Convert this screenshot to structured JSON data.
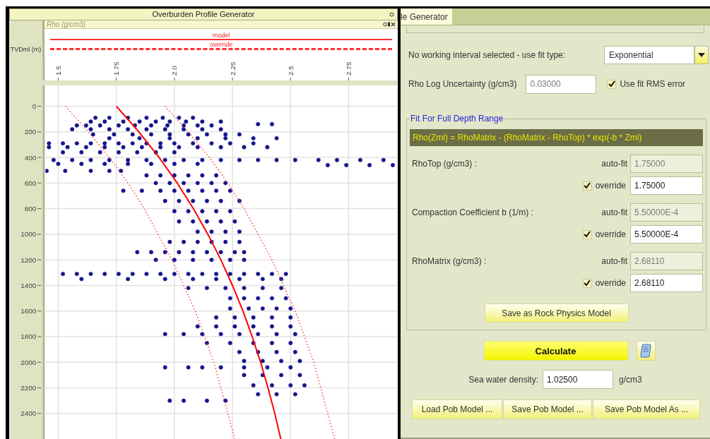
{
  "left_panel": {
    "title": "Overburden Profile Generator",
    "depth_label": "TVDml (m)",
    "track": {
      "title": "Rho (g/cm3)",
      "legend": [
        {
          "label": "model",
          "kind": "solid"
        },
        {
          "label": "override",
          "kind": "dashed"
        }
      ],
      "chart_data": {
        "type": "scatter",
        "grid": true,
        "xlim": [
          1.445,
          2.96
        ],
        "ylim": [
          2600,
          -163
        ],
        "xticks": [
          {
            "value": 1.5,
            "label": "1.5"
          },
          {
            "value": 1.75,
            "label": "1.75"
          },
          {
            "value": 2,
            "label": "2.0"
          },
          {
            "value": 2.25,
            "label": "2.25"
          },
          {
            "value": 2.5,
            "label": "2.5"
          },
          {
            "value": 2.75,
            "label": "2.75"
          }
        ],
        "yticks": [
          {
            "value": 0,
            "label": "0"
          },
          {
            "value": 200,
            "label": "200"
          },
          {
            "value": 400,
            "label": "400"
          },
          {
            "value": 600,
            "label": "600"
          },
          {
            "value": 800,
            "label": "800"
          },
          {
            "value": 1000,
            "label": "1000"
          },
          {
            "value": 1200,
            "label": "1200"
          },
          {
            "value": 1400,
            "label": "1400"
          },
          {
            "value": 1600,
            "label": "1600"
          },
          {
            "value": 1800,
            "label": "1800"
          },
          {
            "value": 2000,
            "label": "2000"
          },
          {
            "value": 2200,
            "label": "2200"
          },
          {
            "value": 2400,
            "label": "2400"
          }
        ],
        "x": [
          1.75,
          1.847,
          1.934,
          2.012,
          2.082,
          2.144,
          2.2,
          2.25,
          2.295,
          2.335,
          2.371,
          2.403,
          2.432,
          2.458,
          1.53,
          1.63,
          1.72,
          1.8,
          1.87,
          1.93,
          1.99,
          2.04,
          2.09,
          2.13,
          2.17,
          2.2,
          2.23,
          2.26,
          1.96,
          2.06,
          2.15,
          2.23,
          2.3,
          2.36,
          2.42,
          2.47,
          2.52,
          2.56,
          2.6,
          2.63,
          2.66,
          2.69,
          1.66,
          1.72,
          1.8,
          1.88,
          1.95,
          2.02,
          2.08,
          1.64,
          1.7,
          1.78,
          1.85,
          1.92,
          1.98,
          2.05,
          2.12,
          2.2,
          2.36,
          2.42,
          1.58,
          1.62,
          1.68,
          1.76,
          1.83,
          1.9,
          1.97,
          2.04,
          2.1,
          2.16,
          1.56,
          1.64,
          1.72,
          1.8,
          1.88,
          1.96,
          2.04,
          2.12,
          2.2,
          1.65,
          1.74,
          1.82,
          1.9,
          1.98,
          2.06,
          2.14,
          2.22,
          2.28,
          1.72,
          1.85,
          1.98,
          2.1,
          2.22,
          2.34,
          2.44,
          1.46,
          1.52,
          1.58,
          1.64,
          1.7,
          1.76,
          1.82,
          1.88,
          1.94,
          2,
          2.08,
          2.16,
          2.24,
          2.34,
          1.46,
          1.54,
          1.62,
          1.7,
          1.78,
          1.86,
          1.94,
          2.02,
          2.1,
          2.2,
          2.3,
          2.4,
          1.52,
          1.6,
          1.68,
          1.76,
          1.84,
          1.92,
          2,
          1.48,
          1.56,
          1.64,
          1.72,
          1.8,
          1.88,
          1.96,
          2.04,
          2.12,
          2.2,
          2.28,
          2.36,
          2.44,
          2.52,
          2.62,
          2.7,
          2.8,
          2.9,
          1.5,
          1.6,
          1.7,
          1.8,
          1.9,
          2,
          2.1,
          2.66,
          2.74,
          2.84,
          2.94,
          1.45,
          1.53,
          1.64,
          1.72,
          1.77,
          1.88,
          1.94,
          2,
          2.06,
          2.12,
          2.18,
          1.92,
          1.98,
          2.04,
          2.1,
          2.16,
          2.22,
          1.78,
          1.86,
          1.94,
          2,
          2.06,
          2.12,
          2.18,
          2.24,
          1.96,
          2.02,
          2.08,
          2.14,
          2.2,
          2.28,
          2,
          2.06,
          2.12,
          2.18,
          2.24,
          2.02,
          2.08,
          2.14,
          2.2,
          2.26,
          2.1,
          2.16,
          2.22,
          2.28,
          1.98,
          2.04,
          2.1,
          2.16,
          2.22,
          2.28,
          1.84,
          1.9,
          1.96,
          2.02,
          2.08,
          2.14,
          2.2,
          2.26,
          2.3,
          1.92,
          2,
          2.08,
          2.16,
          2.24,
          2.3,
          1.52,
          1.58,
          1.64,
          1.7,
          1.76,
          1.82,
          1.88,
          1.94,
          2,
          2.06,
          2.12,
          2.18,
          2.24,
          2.3,
          2.36,
          2.42,
          2.48,
          1.6,
          1.8,
          1.96,
          2.08,
          2.18,
          2.28,
          2.38,
          2.46,
          2.06,
          2.14,
          2.22,
          2.3,
          2.38,
          2.46,
          2.24,
          2.3,
          2.36,
          2.42,
          2.48,
          2.24,
          2.32,
          2.38,
          2.44,
          2.5,
          2.18,
          2.26,
          2.34,
          2.42,
          2.5,
          2.1,
          2.18,
          2.26,
          2.34,
          2.42,
          2.5,
          1.96,
          2.04,
          2.12,
          2.2,
          2.28,
          2.36,
          2.44,
          2.52,
          2.14,
          2.24,
          2.34,
          2.42,
          2.5,
          2.28,
          2.36,
          2.44,
          2.52,
          2.3,
          2.38,
          2.46,
          2.54,
          1.96,
          2.06,
          2.12,
          2.2,
          2.3,
          2.4,
          2.5,
          2.3,
          2.38,
          2.46,
          2.54,
          2.34,
          2.42,
          2.5,
          2.56,
          2.36,
          2.44,
          2.52,
          1.98,
          2.04,
          2.14,
          2.22
        ],
        "series": [
          {
            "color": "#14148c",
            "values": [
              null,
              null,
              null,
              null,
              null,
              null,
              null,
              null,
              null,
              null,
              null,
              null,
              null,
              null,
              null,
              null,
              null,
              null,
              null,
              null,
              null,
              null,
              null,
              null,
              null,
              null,
              null,
              null,
              null,
              null,
              null,
              null,
              null,
              null,
              null,
              null,
              null,
              null,
              null,
              null,
              null,
              null,
              90,
              90,
              90,
              90,
              90,
              90,
              90,
              120,
              120,
              120,
              120,
              120,
              120,
              120,
              120,
              120,
              140,
              140,
              150,
              150,
              150,
              150,
              150,
              150,
              150,
              150,
              150,
              150,
              180,
              180,
              180,
              180,
              180,
              180,
              180,
              180,
              180,
              220,
              220,
              220,
              220,
              220,
              220,
              220,
              220,
              220,
              250,
              250,
              250,
              250,
              250,
              250,
              250,
              290,
              290,
              290,
              290,
              290,
              290,
              290,
              290,
              290,
              290,
              290,
              290,
              290,
              290,
              320,
              320,
              320,
              320,
              320,
              320,
              320,
              320,
              320,
              320,
              320,
              320,
              360,
              360,
              360,
              360,
              360,
              360,
              360,
              420,
              420,
              420,
              420,
              420,
              420,
              420,
              420,
              420,
              420,
              420,
              420,
              420,
              420,
              420,
              420,
              420,
              420,
              450,
              450,
              450,
              450,
              450,
              450,
              450,
              460,
              460,
              460,
              460,
              505,
              505,
              505,
              505,
              505,
              540,
              540,
              540,
              540,
              540,
              540,
              600,
              600,
              600,
              600,
              600,
              600,
              660,
              660,
              660,
              660,
              660,
              660,
              660,
              660,
              740,
              740,
              740,
              740,
              740,
              740,
              820,
              820,
              820,
              820,
              820,
              900,
              900,
              900,
              900,
              900,
              980,
              980,
              980,
              980,
              1060,
              1060,
              1060,
              1060,
              1060,
              1060,
              1140,
              1140,
              1140,
              1140,
              1140,
              1140,
              1140,
              1140,
              1140,
              1200,
              1200,
              1200,
              1200,
              1200,
              1200,
              1310,
              1310,
              1310,
              1310,
              1310,
              1310,
              1310,
              1310,
              1310,
              1310,
              1310,
              1310,
              1310,
              1310,
              1310,
              1310,
              1310,
              1350,
              1350,
              1350,
              1350,
              1350,
              1350,
              1350,
              1350,
              1420,
              1420,
              1420,
              1420,
              1420,
              1420,
              1500,
              1500,
              1500,
              1500,
              1500,
              1580,
              1580,
              1580,
              1580,
              1580,
              1650,
              1650,
              1650,
              1650,
              1650,
              1720,
              1720,
              1720,
              1720,
              1720,
              1720,
              1780,
              1780,
              1780,
              1780,
              1780,
              1780,
              1780,
              1780,
              1850,
              1850,
              1850,
              1850,
              1850,
              1920,
              1920,
              1920,
              1920,
              1990,
              1990,
              1990,
              1990,
              2040,
              2040,
              2040,
              2040,
              2040,
              2040,
              2040,
              2100,
              2100,
              2100,
              2100,
              2180,
              2180,
              2180,
              2180,
              2250,
              2250,
              2250,
              2300,
              2300,
              2300,
              2300
            ]
          },
          {
            "color": "#ff0000",
            "type": "line",
            "line_style": "solid",
            "values": [
              0,
              200,
              400,
              600,
              800,
              1000,
              1200,
              1400,
              1600,
              1800,
              2000,
              2200,
              2400,
              2600,
              null,
              null,
              null,
              null,
              null,
              null,
              null,
              null,
              null,
              null,
              null,
              null,
              null,
              null,
              null,
              null,
              null,
              null,
              null,
              null,
              null,
              null,
              null,
              null,
              null,
              null,
              null,
              null,
              null,
              null,
              null,
              null,
              null,
              null,
              null,
              null,
              null,
              null,
              null,
              null,
              null,
              null,
              null,
              null,
              null,
              null,
              null,
              null,
              null,
              null,
              null,
              null,
              null,
              null,
              null,
              null,
              null,
              null,
              null,
              null,
              null,
              null,
              null,
              null,
              null,
              null,
              null,
              null,
              null,
              null,
              null,
              null,
              null,
              null,
              null,
              null,
              null,
              null,
              null,
              null,
              null,
              null,
              null,
              null,
              null,
              null,
              null,
              null,
              null,
              null,
              null,
              null,
              null,
              null,
              null,
              null,
              null,
              null,
              null,
              null,
              null,
              null,
              null,
              null,
              null,
              null,
              null,
              null,
              null,
              null,
              null,
              null,
              null,
              null,
              null,
              null,
              null,
              null,
              null,
              null,
              null,
              null,
              null,
              null,
              null,
              null,
              null,
              null,
              null,
              null,
              null,
              null,
              null,
              null,
              null,
              null,
              null,
              null,
              null,
              null,
              null,
              null,
              null,
              null,
              null,
              null,
              null,
              null,
              null,
              null,
              null,
              null,
              null,
              null,
              null,
              null,
              null,
              null,
              null,
              null,
              null,
              null,
              null,
              null,
              null,
              null,
              null,
              null,
              null,
              null,
              null,
              null,
              null,
              null,
              null,
              null,
              null,
              null,
              null,
              null,
              null,
              null,
              null,
              null,
              null,
              null,
              null,
              null,
              null,
              null,
              null,
              null,
              null,
              null,
              null,
              null,
              null,
              null,
              null,
              null,
              null,
              null,
              null,
              null,
              null,
              null,
              null,
              null,
              null,
              null,
              null,
              null,
              null,
              null,
              null,
              null,
              null,
              null,
              null,
              null,
              null,
              null,
              null,
              null,
              null,
              null,
              null,
              null,
              null,
              null,
              null,
              null,
              null,
              null,
              null,
              null,
              null,
              null,
              null,
              null,
              null,
              null,
              null,
              null,
              null,
              null,
              null,
              null,
              null,
              null,
              null,
              null,
              null,
              null,
              null,
              null,
              null,
              null,
              null,
              null,
              null,
              null,
              null,
              null,
              null,
              null,
              null,
              null,
              null,
              null,
              null,
              null,
              null,
              null,
              null,
              null,
              null,
              null,
              null,
              null,
              null,
              null,
              null,
              null,
              null,
              null,
              null,
              null,
              null,
              null,
              null,
              null,
              null,
              null,
              null,
              null,
              null,
              null,
              null,
              null,
              null,
              null,
              null,
              null
            ]
          },
          {
            "color": "#ff4040",
            "type": "line",
            "line_style": "dotted",
            "values": [
              null,
              null,
              null,
              null,
              null,
              null,
              null,
              null,
              null,
              null,
              null,
              null,
              null,
              null,
              0,
              200,
              400,
              600,
              800,
              1000,
              1200,
              1400,
              1600,
              1800,
              2000,
              2200,
              2400,
              2600,
              null,
              null,
              null,
              null,
              null,
              null,
              null,
              null,
              null,
              null,
              null,
              null,
              null,
              null,
              null,
              null,
              null,
              null,
              null,
              null,
              null,
              null,
              null,
              null,
              null,
              null,
              null,
              null,
              null,
              null,
              null,
              null,
              null,
              null,
              null,
              null,
              null,
              null,
              null,
              null,
              null,
              null,
              null,
              null,
              null,
              null,
              null,
              null,
              null,
              null,
              null,
              null,
              null,
              null,
              null,
              null,
              null,
              null,
              null,
              null,
              null,
              null,
              null,
              null,
              null,
              null,
              null,
              null,
              null,
              null,
              null,
              null,
              null,
              null,
              null,
              null,
              null,
              null,
              null,
              null,
              null,
              null,
              null,
              null,
              null,
              null,
              null,
              null,
              null,
              null,
              null,
              null,
              null,
              null,
              null,
              null,
              null,
              null,
              null,
              null,
              null,
              null,
              null,
              null,
              null,
              null,
              null,
              null,
              null,
              null,
              null,
              null,
              null,
              null,
              null,
              null,
              null,
              null,
              null,
              null,
              null,
              null,
              null,
              null,
              null,
              null,
              null,
              null,
              null,
              null,
              null,
              null,
              null,
              null,
              null,
              null,
              null,
              null,
              null,
              null,
              null,
              null,
              null,
              null,
              null,
              null,
              null,
              null,
              null,
              null,
              null,
              null,
              null,
              null,
              null,
              null,
              null,
              null,
              null,
              null,
              null,
              null,
              null,
              null,
              null,
              null,
              null,
              null,
              null,
              null,
              null,
              null,
              null,
              null,
              null,
              null,
              null,
              null,
              null,
              null,
              null,
              null,
              null,
              null,
              null,
              null,
              null,
              null,
              null,
              null,
              null,
              null,
              null,
              null,
              null,
              null,
              null,
              null,
              null,
              null,
              null,
              null,
              null,
              null,
              null,
              null,
              null,
              null,
              null,
              null,
              null,
              null,
              null,
              null,
              null,
              null,
              null,
              null,
              null,
              null,
              null,
              null,
              null,
              null,
              null,
              null,
              null,
              null,
              null,
              null,
              null,
              null,
              null,
              null,
              null,
              null,
              null,
              null,
              null,
              null,
              null,
              null,
              null,
              null,
              null,
              null,
              null,
              null,
              null,
              null,
              null,
              null,
              null,
              null,
              null,
              null,
              null,
              null,
              null,
              null,
              null,
              null,
              null,
              null,
              null,
              null,
              null,
              null,
              null,
              null,
              null,
              null,
              null,
              null,
              null,
              null,
              null,
              null,
              null,
              null,
              null,
              null,
              null,
              null,
              null,
              null,
              null,
              null,
              null,
              null
            ]
          },
          {
            "color": "#ff4040",
            "type": "line",
            "line_style": "dotted",
            "values": [
              null,
              null,
              null,
              null,
              null,
              null,
              null,
              null,
              null,
              null,
              null,
              null,
              null,
              null,
              null,
              null,
              null,
              null,
              null,
              null,
              null,
              null,
              null,
              null,
              null,
              null,
              null,
              null,
              0,
              200,
              400,
              600,
              800,
              1000,
              1200,
              1400,
              1600,
              1800,
              2000,
              2200,
              2400,
              2600,
              null,
              null,
              null,
              null,
              null,
              null,
              null,
              null,
              null,
              null,
              null,
              null,
              null,
              null,
              null,
              null,
              null,
              null,
              null,
              null,
              null,
              null,
              null,
              null,
              null,
              null,
              null,
              null,
              null,
              null,
              null,
              null,
              null,
              null,
              null,
              null,
              null,
              null,
              null,
              null,
              null,
              null,
              null,
              null,
              null,
              null,
              null,
              null,
              null,
              null,
              null,
              null,
              null,
              null,
              null,
              null,
              null,
              null,
              null,
              null,
              null,
              null,
              null,
              null,
              null,
              null,
              null,
              null,
              null,
              null,
              null,
              null,
              null,
              null,
              null,
              null,
              null,
              null,
              null,
              null,
              null,
              null,
              null,
              null,
              null,
              null,
              null,
              null,
              null,
              null,
              null,
              null,
              null,
              null,
              null,
              null,
              null,
              null,
              null,
              null,
              null,
              null,
              null,
              null,
              null,
              null,
              null,
              null,
              null,
              null,
              null,
              null,
              null,
              null,
              null,
              null,
              null,
              null,
              null,
              null,
              null,
              null,
              null,
              null,
              null,
              null,
              null,
              null,
              null,
              null,
              null,
              null,
              null,
              null,
              null,
              null,
              null,
              null,
              null,
              null,
              null,
              null,
              null,
              null,
              null,
              null,
              null,
              null,
              null,
              null,
              null,
              null,
              null,
              null,
              null,
              null,
              null,
              null,
              null,
              null,
              null,
              null,
              null,
              null,
              null,
              null,
              null,
              null,
              null,
              null,
              null,
              null,
              null,
              null,
              null,
              null,
              null,
              null,
              null,
              null,
              null,
              null,
              null,
              null,
              null,
              null,
              null,
              null,
              null,
              null,
              null,
              null,
              null,
              null,
              null,
              null,
              null,
              null,
              null,
              null,
              null,
              null,
              null,
              null,
              null,
              null,
              null,
              null,
              null,
              null,
              null,
              null,
              null,
              null,
              null,
              null,
              null,
              null,
              null,
              null,
              null,
              null,
              null,
              null,
              null,
              null,
              null,
              null,
              null,
              null,
              null,
              null,
              null,
              null,
              null,
              null,
              null,
              null,
              null,
              null,
              null,
              null,
              null,
              null,
              null,
              null,
              null,
              null,
              null,
              null,
              null,
              null,
              null,
              null,
              null,
              null,
              null,
              null,
              null,
              null,
              null,
              null,
              null,
              null,
              null,
              null,
              null,
              null,
              null,
              null,
              null,
              null,
              null,
              null,
              null,
              null
            ]
          }
        ]
      }
    }
  },
  "right_panel": {
    "tab": {
      "label": "le Generator",
      "selected": true
    },
    "fit_type": {
      "label": "No working interval selected - use fit type:",
      "value": "Exponential"
    },
    "uncertainty": {
      "label": "Rho Log Uncertainty (g/cm3)",
      "value": "0.03000",
      "disabled": true
    },
    "use_rms": {
      "label": "Use fit RMS error",
      "checked": true
    },
    "fit_group": {
      "title": "Fit For Full Depth Range",
      "formula": "Rho(Zml) = RhoMatrix - (RhoMatrix - RhoTop) * exp(-b * Zml)",
      "params": [
        {
          "label": "RhoTop (g/cm3) :",
          "auto_fit": {
            "label": "auto-fit",
            "value": "1.75000",
            "disabled": true
          },
          "override": {
            "label": "override",
            "checked": true,
            "value": "1.75000"
          }
        },
        {
          "label": "Compaction Coefficient b (1/m) :",
          "auto_fit": {
            "label": "auto-fit",
            "value": "5.50000E-4",
            "disabled": true
          },
          "override": {
            "label": "override",
            "checked": true,
            "value": "5.50000E-4"
          }
        },
        {
          "label": "RhoMatrix (g/cm3) :",
          "auto_fit": {
            "label": "auto-fit",
            "value": "2.68110",
            "disabled": true
          },
          "override": {
            "label": "override",
            "checked": true,
            "value": "2.68110"
          }
        }
      ],
      "save_button": "Save as Rock Physics Model"
    },
    "calculate_button": "Calculate",
    "sea_water": {
      "label": "Sea water density:",
      "value": "1.02500",
      "unit": "g/cm3"
    },
    "buttons": [
      "Load Pob Model ...",
      "Save Pob Model ...",
      "Save Pob Model As ..."
    ]
  }
}
